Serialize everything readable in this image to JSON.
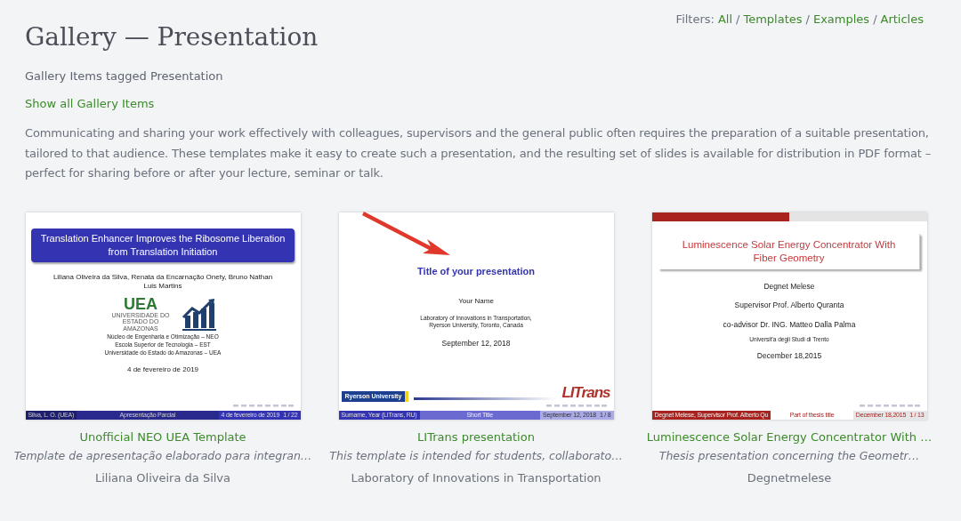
{
  "filters": {
    "label": "Filters:",
    "separator": "/",
    "items": [
      {
        "label": "All"
      },
      {
        "label": "Templates"
      },
      {
        "label": "Examples"
      },
      {
        "label": "Articles"
      }
    ]
  },
  "title": "Gallery — Presentation",
  "subtitle": "Gallery Items tagged Presentation",
  "show_all_link": "Show all Gallery Items",
  "description": "Communicating and sharing your work effectively with colleagues, supervisors and the general public often requires the preparation of a suitable presentation, tailored to that audience. These templates make it easy to create such a presentation, and the resulting set of slides is available for distribution in PDF format – perfect for sharing before or after your lecture, seminar or talk.",
  "items": [
    {
      "kind": "banner",
      "slide": {
        "title": "Translation Enhancer Improves the Ribosome Liberation from Translation Initiation",
        "lines": [
          "Liliana Oliveira da Silva, Renata da Encarnação Onety, Bruno Nathan Luis Martins"
        ],
        "logo_text": "UEA",
        "logo_caption": "UNIVERSIDADE DO ESTADO DO AMAZONAS",
        "institution": [
          "Núcleo de Engenharia e Otimização – NEO",
          "Escola Superior de Tecnologia – EST",
          "Universidade do Estado do Amazonas – UEA"
        ],
        "date": "4 de fevereiro de 2019",
        "footer": [
          "Silva, L. O. (UEA)",
          "Apresentação Parcial",
          "4 de fevereiro de 2019",
          "1 / 22"
        ]
      },
      "title": "Unofficial NEO UEA Template",
      "description": "Template de apresentação elaborado para integran…",
      "author": "Liliana Oliveira da Silva"
    },
    {
      "kind": "plain",
      "slide": {
        "title": "Title of your presentation",
        "lines": [
          "Your Name"
        ],
        "institution": [
          "Laboratory of Innovations in Transportation,",
          "Ryerson University, Toronto, Canada"
        ],
        "date": "September 12, 2018",
        "logo_text": "Ryerson University",
        "logo_right": "LITrans",
        "footer": [
          "Surname, Year (LITrans, RU)",
          "Short Title",
          "September 12, 2018",
          "1 / 8"
        ]
      },
      "title": "LITrans presentation",
      "description": "This template is intended for students, collaborato…",
      "author": "Laboratory of Innovations in Transportation"
    },
    {
      "kind": "shadowbox",
      "slide": {
        "title": "Luminescence Solar Energy Concentrator With Fiber Geometry",
        "lines": [
          "Degnet Melese",
          "Supervisor Prof. Alberto Quranta",
          "co-advisor Dr. ING. Matteo Dalla Palma"
        ],
        "institution": [
          "Universit'a degli Studi di Trento"
        ],
        "date": "December 18,2015",
        "footer": [
          "Degnet Melese, Supervisor Prof. Alberto Qu",
          "Part of thesis title",
          "December 18,2015",
          "1 / 13"
        ]
      },
      "title": "Luminescence Solar Energy Concentrator With …",
      "description": "Thesis presentation concerning the Geometr…",
      "author": "Degnetmelese"
    }
  ]
}
